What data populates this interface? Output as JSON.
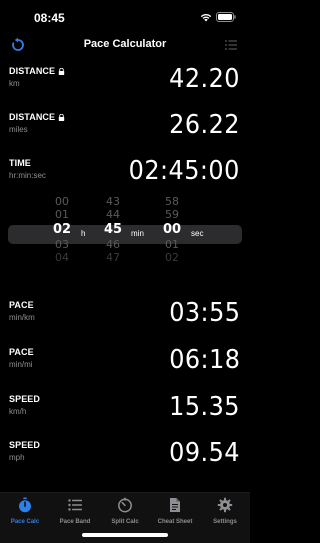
{
  "status_bar": {
    "time": "08:45"
  },
  "nav": {
    "title": "Pace Calculator"
  },
  "rows": {
    "distance_km": {
      "label": "DISTANCE",
      "unit": "km",
      "value": "42.20"
    },
    "distance_mi": {
      "label": "DISTANCE",
      "unit": "miles",
      "value": "26.22"
    },
    "time": {
      "label": "TIME",
      "unit": "hr:min:sec",
      "value": "02:45:00"
    },
    "pace_km": {
      "label": "PACE",
      "unit": "min/km",
      "value": "03:55"
    },
    "pace_mi": {
      "label": "PACE",
      "unit": "min/mi",
      "value": "06:18"
    },
    "speed_kmh": {
      "label": "SPEED",
      "unit": "km/h",
      "value": "15.35"
    },
    "speed_mph": {
      "label": "SPEED",
      "unit": "mph",
      "value": "09.54"
    }
  },
  "picker": {
    "hours": {
      "above": [
        "00",
        "01"
      ],
      "selected": "02",
      "below": [
        "03",
        "04"
      ],
      "unit": "h"
    },
    "minutes": {
      "above": [
        "43",
        "44"
      ],
      "selected": "45",
      "below": [
        "46",
        "47"
      ],
      "unit": "min"
    },
    "seconds": {
      "above": [
        "58",
        "59"
      ],
      "selected": "00",
      "below": [
        "01",
        "02"
      ],
      "unit": "sec"
    }
  },
  "tabs": [
    {
      "label": "Pace Calc",
      "icon": "stopwatch-icon",
      "active": true
    },
    {
      "label": "Pace Band",
      "icon": "list-icon",
      "active": false
    },
    {
      "label": "Split Calc",
      "icon": "timer-icon",
      "active": false
    },
    {
      "label": "Cheat Sheet",
      "icon": "document-icon",
      "active": false
    },
    {
      "label": "Settings",
      "icon": "gear-icon",
      "active": false
    }
  ],
  "colors": {
    "accent": "#2f7fe8",
    "background": "#000000",
    "secondary_text": "#8e8e93",
    "picker_band": "#2c2c2e"
  }
}
